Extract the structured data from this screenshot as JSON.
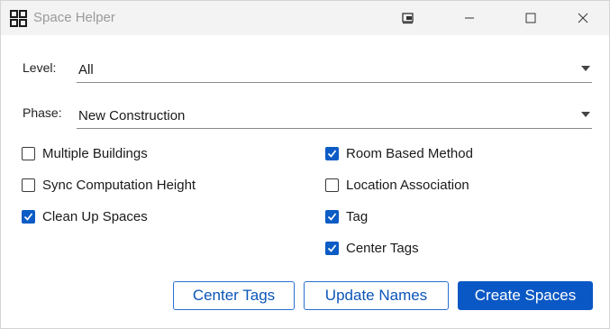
{
  "window": {
    "title": "Space Helper",
    "icons": {
      "app": "grid-icon",
      "extra": "window-pin-icon",
      "minimize": "minimize-icon",
      "maximize": "maximize-icon",
      "close": "close-icon"
    }
  },
  "form": {
    "level_label": "Level:",
    "level_value": "All",
    "phase_label": "Phase:",
    "phase_value": "New Construction"
  },
  "options_left": [
    {
      "label": "Multiple Buildings",
      "checked": false
    },
    {
      "label": "Sync Computation Height",
      "checked": false
    },
    {
      "label": "Clean Up Spaces",
      "checked": true
    }
  ],
  "options_right": [
    {
      "label": "Room Based Method",
      "checked": true
    },
    {
      "label": "Location Association",
      "checked": false
    },
    {
      "label": "Tag",
      "checked": true
    },
    {
      "label": "Center Tags",
      "checked": true
    }
  ],
  "buttons": {
    "center_tags": "Center Tags",
    "update_names": "Update Names",
    "create_spaces": "Create Spaces"
  },
  "colors": {
    "accent": "#0a58c5",
    "title_text": "#9a9a9a"
  }
}
